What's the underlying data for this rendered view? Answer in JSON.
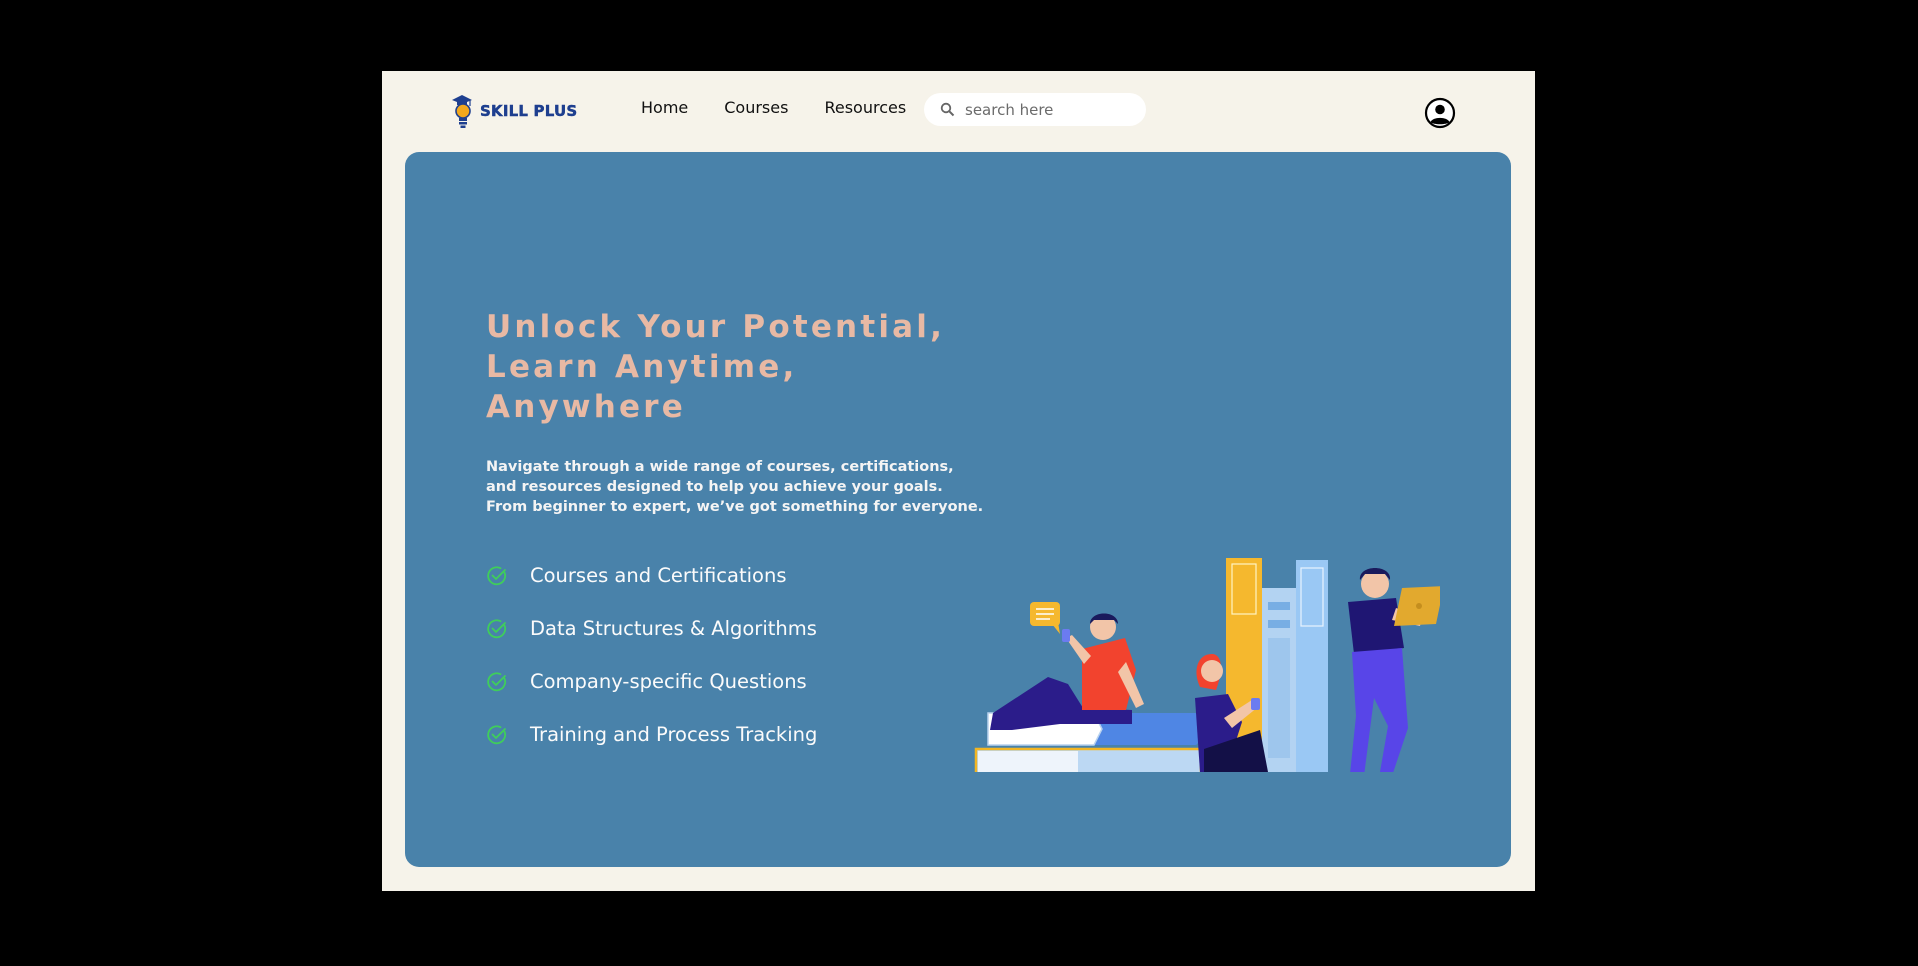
{
  "brand": {
    "name": "SKILL PLUS",
    "logo_icon": "lightbulb-graduation-cap-icon"
  },
  "nav": {
    "items": [
      "Home",
      "Courses",
      "Resources"
    ]
  },
  "search": {
    "placeholder": "search here",
    "value": "",
    "icon": "search-icon"
  },
  "account": {
    "icon": "user-circle-icon"
  },
  "hero": {
    "headline_lines": [
      "Unlock Your Potential,",
      "Learn Anytime,",
      "Anywhere"
    ],
    "description": "Navigate through a wide range of courses, certifications, and resources designed to help you achieve your goals. From beginner to expert, we’ve got something for everyone.",
    "features": [
      "Courses and Certifications",
      "Data Structures & Algorithms",
      "Company-specific Questions",
      "Training and Process Tracking"
    ],
    "feature_icon": "check-circle-icon",
    "illustration": "students-with-books-illustration"
  },
  "colors": {
    "page_bg": "#f6f3ea",
    "hero_bg": "#4982aa",
    "headline": "#e8b9a4",
    "brand_text": "#1e3f8f",
    "check": "#3fce5a"
  }
}
